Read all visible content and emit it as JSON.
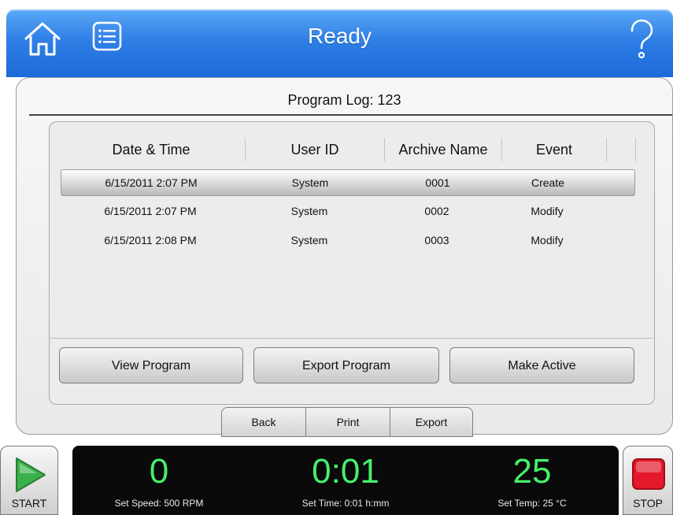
{
  "header": {
    "title": "Ready",
    "icons": {
      "home": "home-icon",
      "menu": "list-icon",
      "help": "help-icon"
    }
  },
  "page": {
    "title": "Program Log: 123"
  },
  "table": {
    "columns": [
      "Date & Time",
      "User ID",
      "Archive Name",
      "Event"
    ],
    "rows": [
      {
        "date_time": "6/15/2011 2:07 PM",
        "user_id": "System",
        "archive_name": "0001",
        "event": "Create",
        "selected": true
      },
      {
        "date_time": "6/15/2011 2:07 PM",
        "user_id": "System",
        "archive_name": "0002",
        "event": "Modify",
        "selected": false
      },
      {
        "date_time": "6/15/2011 2:08 PM",
        "user_id": "System",
        "archive_name": "0003",
        "event": "Modify",
        "selected": false
      }
    ]
  },
  "actions": {
    "view_program": "View Program",
    "export_program": "Export Program",
    "make_active": "Make Active"
  },
  "tabs": {
    "back": "Back",
    "print": "Print",
    "export": "Export"
  },
  "footer": {
    "start_label": "START",
    "stop_label": "STOP",
    "speed_value": "0",
    "speed_setting": "Set Speed: 500 RPM",
    "time_value": "0:01",
    "time_setting": "Set Time: 0:01 h:mm",
    "temp_value": "25",
    "temp_setting": "Set Temp: 25 °C"
  },
  "colors": {
    "header_blue": "#2f7fe6",
    "display_green": "#46f06a",
    "stop_red": "#e3182a",
    "start_green": "#3bb04a"
  }
}
